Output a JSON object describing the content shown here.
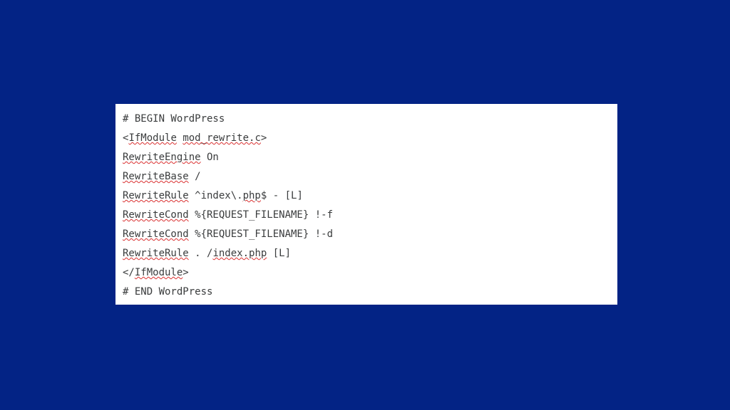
{
  "code": {
    "lines": [
      {
        "runs": [
          {
            "t": "# BEGIN WordPress"
          }
        ]
      },
      {
        "runs": [
          {
            "t": "<"
          },
          {
            "t": "IfModule",
            "m": true
          },
          {
            "t": " "
          },
          {
            "t": "mod_rewrite.c",
            "m": true
          },
          {
            "t": ">"
          }
        ]
      },
      {
        "runs": [
          {
            "t": "RewriteEngine",
            "m": true
          },
          {
            "t": " On"
          }
        ]
      },
      {
        "runs": [
          {
            "t": "RewriteBase",
            "m": true
          },
          {
            "t": " /"
          }
        ]
      },
      {
        "runs": [
          {
            "t": "RewriteRule",
            "m": true
          },
          {
            "t": " ^index\\."
          },
          {
            "t": "php",
            "m": true
          },
          {
            "t": "$ - [L]"
          }
        ]
      },
      {
        "runs": [
          {
            "t": "RewriteCond",
            "m": true
          },
          {
            "t": " %{REQUEST_FILENAME} !-f"
          }
        ]
      },
      {
        "runs": [
          {
            "t": "RewriteCond",
            "m": true
          },
          {
            "t": " %{REQUEST_FILENAME} !-d"
          }
        ]
      },
      {
        "runs": [
          {
            "t": "RewriteRule",
            "m": true
          },
          {
            "t": " . /"
          },
          {
            "t": "index.php",
            "m": true
          },
          {
            "t": " [L]"
          }
        ]
      },
      {
        "runs": [
          {
            "t": "</"
          },
          {
            "t": "IfModule",
            "m": true
          },
          {
            "t": ">"
          }
        ]
      },
      {
        "runs": [
          {
            "t": "# END WordPress"
          }
        ]
      }
    ]
  }
}
